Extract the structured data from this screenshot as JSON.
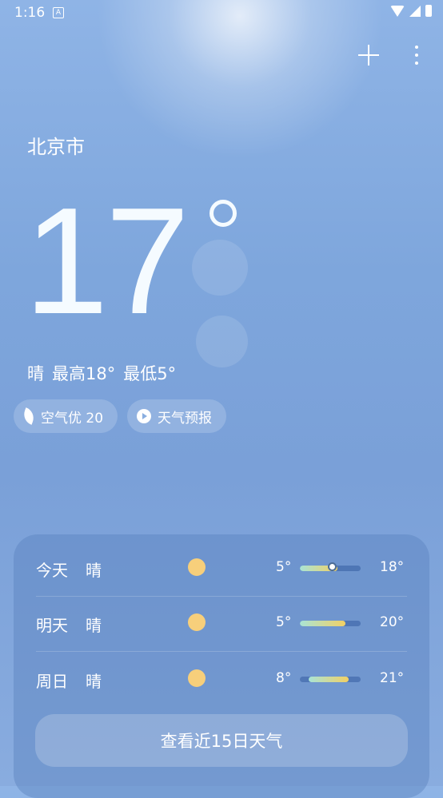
{
  "status_bar": {
    "time": "1:16",
    "notification_glyph": "A"
  },
  "header": {
    "add_icon": "plus-icon",
    "more_icon": "more-vertical-icon"
  },
  "location": {
    "city": "北京市"
  },
  "current": {
    "temperature": "17",
    "condition": "晴",
    "high_label": "最高18°",
    "low_label": "最低5°"
  },
  "chips": [
    {
      "icon": "leaf-icon",
      "label": "空气优 20"
    },
    {
      "icon": "play-icon",
      "label": "天气预报"
    }
  ],
  "forecast": {
    "days": [
      {
        "day": "今天",
        "condition": "晴",
        "icon": "sun-icon",
        "low": "5°",
        "high": "18°",
        "range_start": 0.0,
        "range_end": 0.62,
        "current_marker": 0.53
      },
      {
        "day": "明天",
        "condition": "晴",
        "icon": "sun-icon",
        "low": "5°",
        "high": "20°",
        "range_start": 0.0,
        "range_end": 0.75
      },
      {
        "day": "周日",
        "condition": "晴",
        "icon": "sun-icon",
        "low": "8°",
        "high": "21°",
        "range_start": 0.15,
        "range_end": 0.8
      }
    ],
    "more_label": "查看近15日天气"
  },
  "colors": {
    "sun": "#f7cf7b",
    "range_start": "#a9e4d6",
    "range_end": "#f2d064"
  }
}
